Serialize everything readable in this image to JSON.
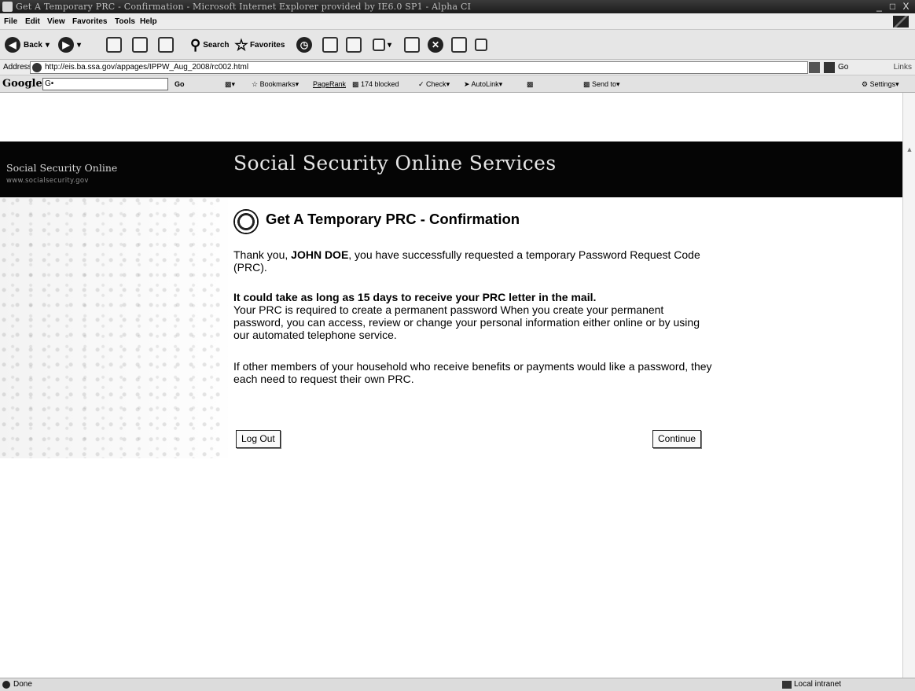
{
  "window": {
    "title": "Get A Temporary PRC - Confirmation - Microsoft Internet Explorer provided by IE6.0 SP1 - Alpha CI",
    "minimize": "_",
    "maximize": "□",
    "close": "X"
  },
  "menu": [
    "File",
    "Edit",
    "View",
    "Favorites",
    "Tools",
    "Help"
  ],
  "toolbar": {
    "back_label": "Back",
    "search_label": "Search",
    "favorites_label": "Favorites"
  },
  "address": {
    "label": "Address",
    "url": "http://eis.ba.ssa.gov/appages/IPPW_Aug_2008/rc002.html",
    "go_label": "Go",
    "links_label": "Links"
  },
  "google_bar": {
    "logo": "Google",
    "search_value": "G•",
    "go_label": "Go",
    "bookmarks_label": "Bookmarks",
    "pagerank_label": "PageRank",
    "blocked_label": "174 blocked",
    "check_label": "Check",
    "autolink_label": "AutoLink",
    "sendto_label": "Send to",
    "settings_label": "Settings"
  },
  "banner": {
    "site_name": "Social Security Online",
    "site_url": "www.socialsecurity.gov",
    "title": "Social Security Online Services"
  },
  "content": {
    "heading": "Get A Temporary PRC - Confirmation",
    "p1_prefix": "Thank you, ",
    "p1_name": "JOHN DOE",
    "p1_suffix": ", you have successfully requested a temporary Password Request Code (PRC).",
    "p2_bold": "It could take as long as 15 days to receive your PRC letter in the mail.",
    "p2_text": "Your PRC is required to create a permanent password  When you create your permanent password, you can access, review or change your personal information either online or by using our automated telephone service.",
    "p3_text": "If other members of your household who receive benefits or payments would like a password, they each need to request their own PRC.",
    "logout_label": "Log Out",
    "continue_label": "Continue"
  },
  "status": {
    "text": "Done",
    "zone": "Local intranet"
  }
}
